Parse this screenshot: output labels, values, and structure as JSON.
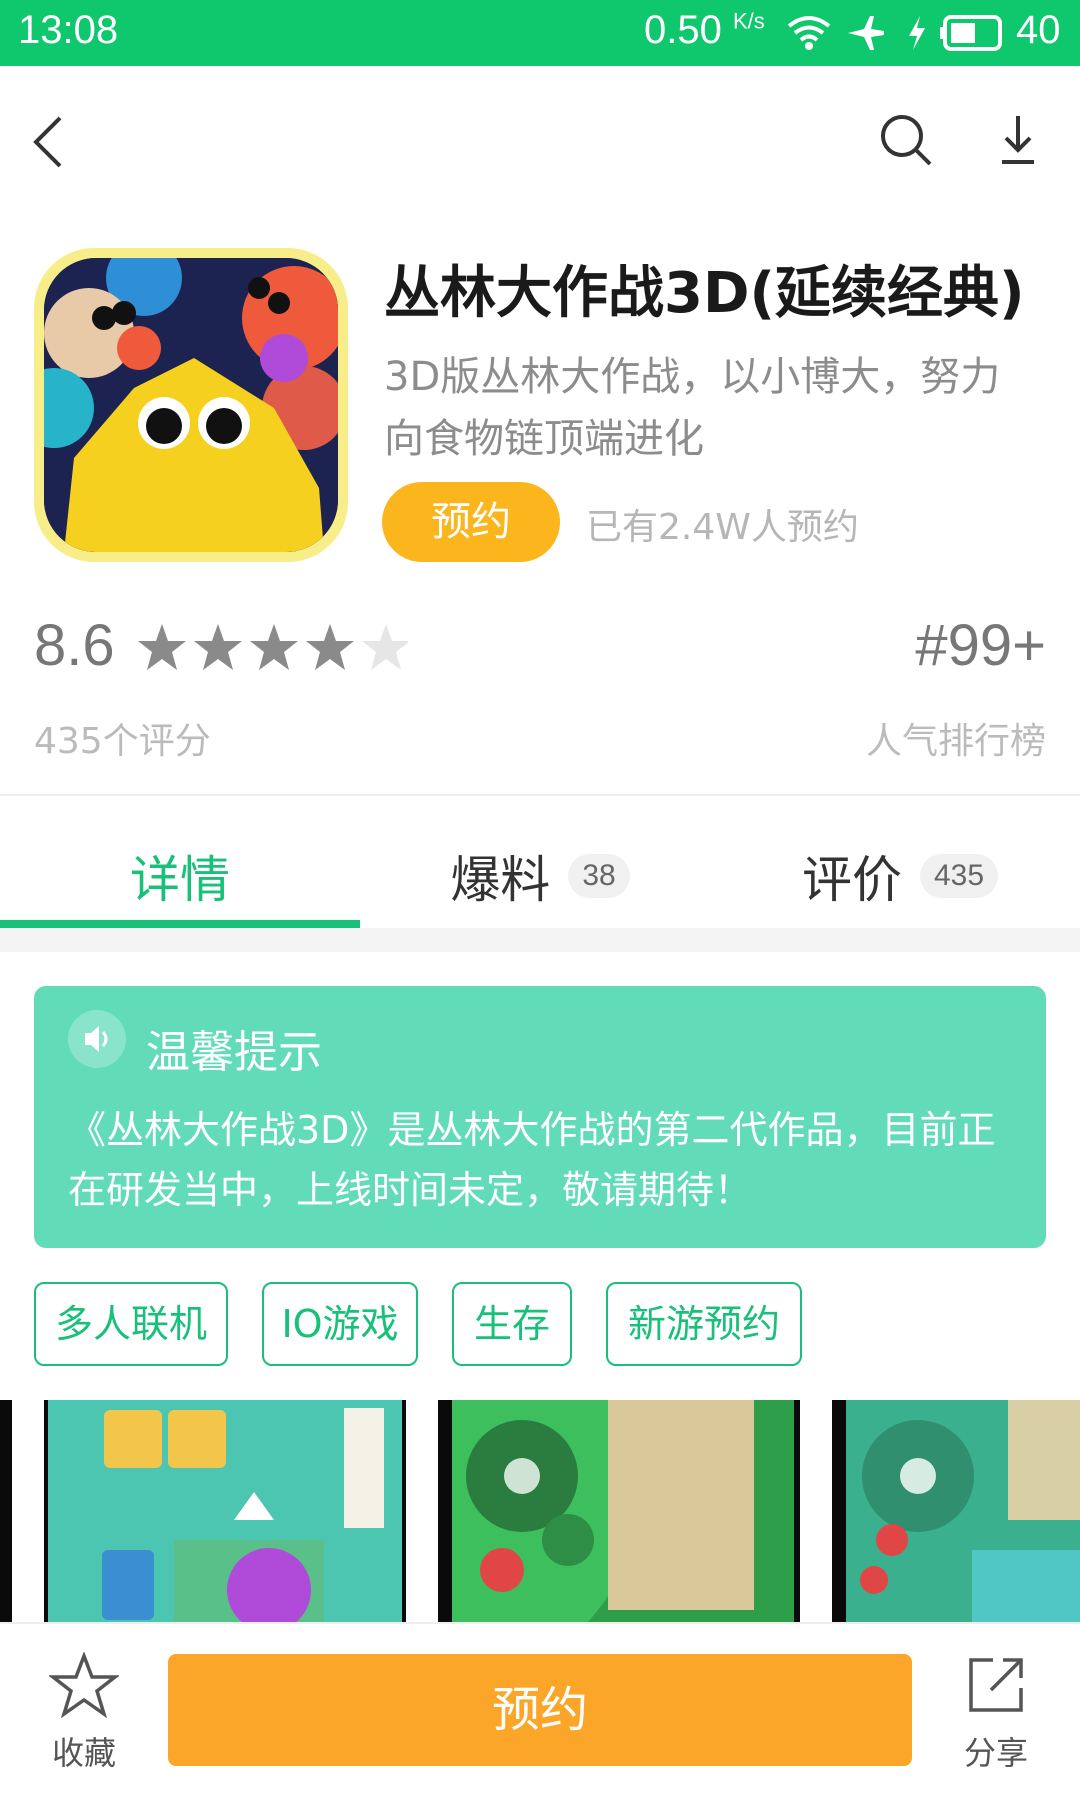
{
  "status_bar": {
    "time": "13:08",
    "speed": "0.50",
    "speed_unit": "K/s",
    "battery": "40"
  },
  "nav": {
    "back": "back-icon",
    "search": "search-icon",
    "download": "download-icon"
  },
  "app": {
    "title": "丛林大作战3D(延续经典)",
    "description": "3D版丛林大作战，以小博大，努力向食物链顶端进化",
    "reserve_label": "预约",
    "reserve_count": "已有2.4W人预约"
  },
  "rating": {
    "score": "8.6",
    "stars": 4.3,
    "count_label": "435个评分",
    "rank": "#99+",
    "rank_label": "人气排行榜"
  },
  "tabs": [
    {
      "label": "详情",
      "badge": ""
    },
    {
      "label": "爆料",
      "badge": "38"
    },
    {
      "label": "评价",
      "badge": "435"
    }
  ],
  "notice": {
    "title": "温馨提示",
    "text": "《丛林大作战3D》是丛林大作战的第二代作品，目前正在研发当中，上线时间未定，敬请期待！"
  },
  "tags": [
    "多人联机",
    "IO游戏",
    "生存",
    "新游预约"
  ],
  "bottom": {
    "favorite": "收藏",
    "reserve": "预约",
    "share": "分享"
  },
  "colors": {
    "primary": "#19c07a",
    "status_bar": "#0fc76c",
    "reserve": "#fbb51d",
    "big_reserve": "#fca629",
    "notice": "#62dbb8"
  }
}
